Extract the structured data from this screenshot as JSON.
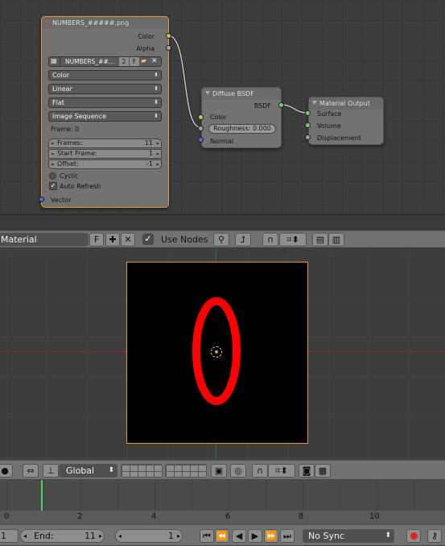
{
  "node_editor": {
    "image_node": {
      "title": "NUMBERS_#####.png",
      "outputs": [
        "Color",
        "Alpha"
      ],
      "image_selector": {
        "name": "NUMBERS_##...",
        "users": "2",
        "fake_user": "F"
      },
      "color_space": "Color",
      "interpolation": "Linear",
      "projection": "Flat",
      "source": "Image Sequence",
      "frame_label": "Frame: 0",
      "frames": {
        "label": "Frames:",
        "value": "11"
      },
      "start_frame": {
        "label": "Start Frame:",
        "value": "1"
      },
      "offset": {
        "label": "Offset:",
        "value": "-1"
      },
      "cyclic": {
        "label": "Cyclic",
        "checked": false
      },
      "auto_refresh": {
        "label": "Auto Refresh",
        "checked": true
      },
      "input": "Vector"
    },
    "diffuse_node": {
      "title": "Diffuse BSDF",
      "output": "BSDF",
      "color_input": "Color",
      "roughness": "Roughness: 0.000",
      "normal_input": "Normal"
    },
    "output_node": {
      "title": "Material Output",
      "inputs": [
        "Surface",
        "Volume",
        "Displacement"
      ]
    }
  },
  "node_header": {
    "material_name": "Material",
    "fake_user": "F",
    "use_nodes_label": "Use Nodes",
    "use_nodes_checked": true
  },
  "viewer": {
    "image_digit": "0",
    "digit_color": "#ff0000",
    "border_color": "#e6963a"
  },
  "view3d_header": {
    "orientation": "Global"
  },
  "timeline": {
    "ticks": [
      "0",
      "2",
      "4",
      "6",
      "8",
      "10"
    ],
    "current_frame": 1
  },
  "playback_bar": {
    "start_value": "1",
    "end_label": "End:",
    "end_value": "11",
    "current_value": "1",
    "sync_mode": "No Sync"
  }
}
